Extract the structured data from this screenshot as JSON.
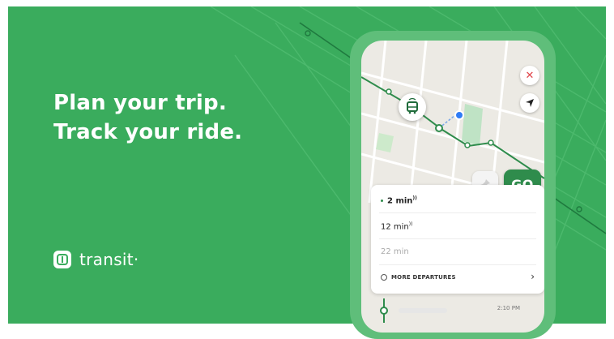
{
  "headline": {
    "line1": "Plan your trip.",
    "line2": "Track your ride."
  },
  "brand": {
    "name": "transit·",
    "logo_icon": "transit-logo-icon"
  },
  "colors": {
    "brand_green": "#3aac5d",
    "go_green": "#2f8c4c",
    "close_red": "#e0454a",
    "location_blue": "#2f7cf6"
  },
  "map": {
    "close_icon": "close-icon",
    "locate_icon": "navigation-arrow-icon",
    "vehicle_icon": "bus-icon",
    "pin_icon": "pin-icon"
  },
  "go_button": {
    "label": "GO"
  },
  "departures": {
    "items": [
      {
        "time": "2 min"
      },
      {
        "time": "12 min"
      },
      {
        "time": "22 min"
      }
    ],
    "more_label": "MORE DEPARTURES",
    "more_icon": "clock-icon",
    "chevron_icon": "chevron-right-icon"
  },
  "next_stop": {
    "time": "2:10 PM"
  }
}
